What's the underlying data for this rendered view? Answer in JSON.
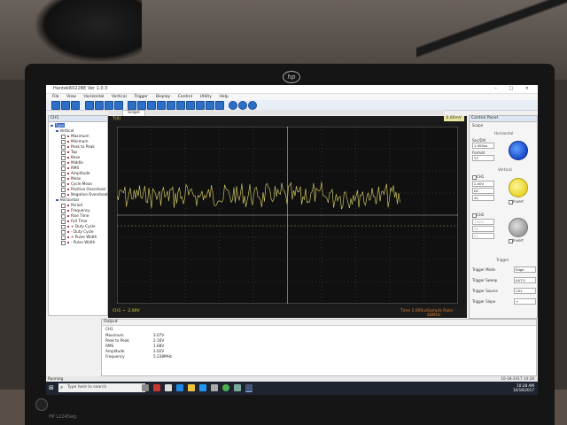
{
  "window": {
    "title": "Hantek6022BE Ver 1.0.3",
    "controls": "–  □  ×"
  },
  "menu": [
    "File",
    "View",
    "Horizontal",
    "Vertical",
    "Trigger",
    "Display",
    "Control",
    "Utility",
    "Help"
  ],
  "tabs": {
    "scope": "Scope"
  },
  "left_panel": {
    "header": "CH1",
    "items": [
      {
        "label": "Type",
        "level": 0,
        "selected": true
      },
      {
        "label": "Vertical",
        "level": 1
      },
      {
        "label": "Maximum",
        "level": 2
      },
      {
        "label": "Minimum",
        "level": 2
      },
      {
        "label": "Peak to Peak",
        "level": 2
      },
      {
        "label": "Top",
        "level": 2
      },
      {
        "label": "Base",
        "level": 2
      },
      {
        "label": "Middle",
        "level": 2
      },
      {
        "label": "RMS",
        "level": 2
      },
      {
        "label": "Amplitude",
        "level": 2
      },
      {
        "label": "Mean",
        "level": 2
      },
      {
        "label": "Cycle Mean",
        "level": 2
      },
      {
        "label": "Positive Overshoot",
        "level": 2
      },
      {
        "label": "Negative Overshoot",
        "level": 2
      },
      {
        "label": "Horizontal",
        "level": 1
      },
      {
        "label": "Period",
        "level": 2
      },
      {
        "label": "Frequency",
        "level": 2
      },
      {
        "label": "Rise Time",
        "level": 2
      },
      {
        "label": "Fall Time",
        "level": 2
      },
      {
        "label": "+ Duty Cycle",
        "level": 2
      },
      {
        "label": "- Duty Cycle",
        "level": 2
      },
      {
        "label": "+ Pulse Width",
        "level": 2
      },
      {
        "label": "- Pulse Width",
        "level": 2
      }
    ]
  },
  "scope": {
    "trigger_label": "T(0)",
    "trigger_voltage": "0.00mV",
    "ch1_label": "CH1 ~",
    "ch1_scale": "2.00V",
    "time_base": "Time 1.000us",
    "sample_rate": "Sample Rate: 48MHz",
    "trace_color": "#c8c060"
  },
  "control_panel": {
    "header": "Control Panel",
    "tab": "Scope",
    "horizontal_title": "Horizontal",
    "time_div_label": "Sec/DIV",
    "time_div_value": "1.000us",
    "format_label": "Format",
    "format_value": "Y-T",
    "vertical_title": "Vertical",
    "ch1_label": "CH1",
    "ch1_volts": "2.00V",
    "ch1_coupling": "DC",
    "ch1_probe": "X1",
    "ch2_label": "CH2",
    "ch2_volts": "1.00V",
    "ch2_coupling": "DC",
    "ch2_probe": "X1",
    "invert1": "Invert",
    "invert2": "Invert",
    "trigger_title": "Trigger",
    "trigger_mode_label": "Trigger Mode",
    "trigger_mode_value": "Edge",
    "trigger_sweep_label": "Trigger Sweep",
    "trigger_sweep_value": "AUTO",
    "trigger_source_label": "Trigger Source",
    "trigger_source_value": "CH1",
    "trigger_slope_label": "Trigger Slope",
    "trigger_slope_value": "+"
  },
  "output": {
    "header": "Output",
    "channel": "CH1",
    "rows": [
      {
        "name": "Maximum",
        "value": "3.07V"
      },
      {
        "name": "Peak to Peak",
        "value": "2.16V"
      },
      {
        "name": "RMS",
        "value": "1.68V"
      },
      {
        "name": "Amplitude",
        "value": "2.02V"
      },
      {
        "name": "Frequency",
        "value": "5.238MHz"
      }
    ]
  },
  "status": {
    "left": "Running",
    "right": "10-18-2017  10:28"
  },
  "taskbar": {
    "search_placeholder": "Type here to search",
    "time": "10:28 AM",
    "date": "10/18/2017"
  },
  "monitor": {
    "brand": "hp",
    "model": "HP L2245wg"
  }
}
